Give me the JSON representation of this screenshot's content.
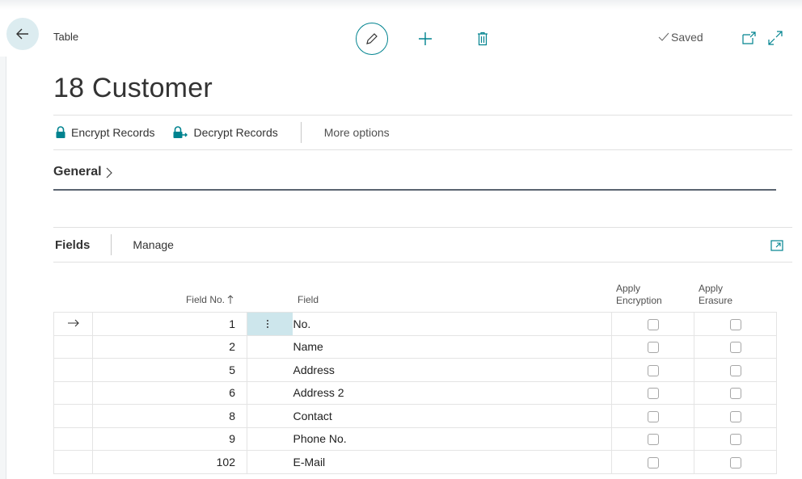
{
  "header": {
    "caption": "Table",
    "title": "18 Customer",
    "saved_label": "Saved"
  },
  "actions": {
    "encrypt_label": "Encrypt Records",
    "decrypt_label": "Decrypt Records",
    "more_label": "More options"
  },
  "general": {
    "label": "General"
  },
  "fields_part": {
    "label": "Fields",
    "manage_label": "Manage"
  },
  "grid": {
    "columns": {
      "field_no": "Field No.",
      "field": "Field",
      "apply_encryption_1": "Apply",
      "apply_encryption_2": "Encryption",
      "apply_erasure_1": "Apply",
      "apply_erasure_2": "Erasure"
    },
    "rows": [
      {
        "no": "1",
        "field": "No.",
        "apply_encryption": false,
        "apply_erasure": false,
        "selected": true
      },
      {
        "no": "2",
        "field": "Name",
        "apply_encryption": false,
        "apply_erasure": false
      },
      {
        "no": "5",
        "field": "Address",
        "apply_encryption": false,
        "apply_erasure": false
      },
      {
        "no": "6",
        "field": "Address 2",
        "apply_encryption": false,
        "apply_erasure": false
      },
      {
        "no": "8",
        "field": "Contact",
        "apply_encryption": false,
        "apply_erasure": false
      },
      {
        "no": "9",
        "field": "Phone No.",
        "apply_encryption": false,
        "apply_erasure": false
      },
      {
        "no": "102",
        "field": "E-Mail",
        "apply_encryption": false,
        "apply_erasure": false
      }
    ]
  },
  "icons": {
    "back": "arrow-left-icon",
    "edit": "pencil-icon",
    "new": "plus-icon",
    "delete": "trash-icon",
    "saved": "check-icon",
    "popout": "open-new-window-icon",
    "expand": "expand-icon",
    "encrypt": "lock-icon",
    "decrypt": "unlock-icon",
    "row_indicator": "arrow-right-icon",
    "sort": "sort-ascending-icon"
  },
  "colors": {
    "accent": "#00838f",
    "back_button_bg": "#dcecf0",
    "selected_cell_bg": "#cde6ec"
  }
}
